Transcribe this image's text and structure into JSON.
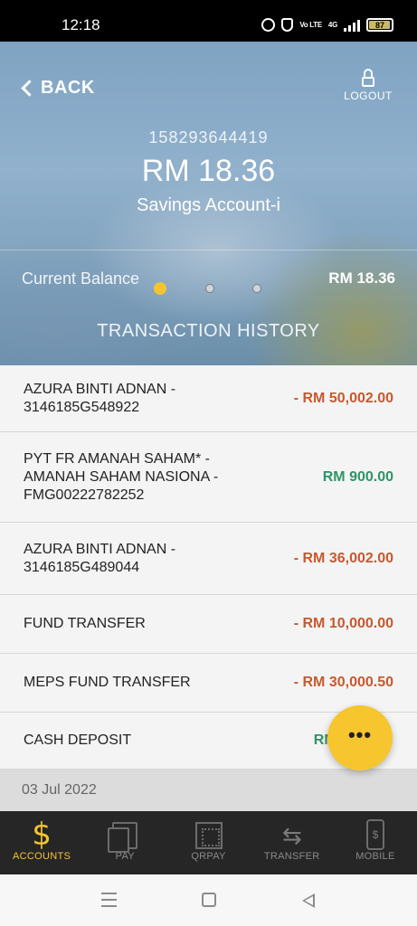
{
  "status_bar": {
    "time": "12:18",
    "network": "4G",
    "volte": "Vo LTE",
    "battery": "87"
  },
  "header": {
    "back_label": "BACK",
    "logout_label": "LOGOUT",
    "account_number": "158293644419",
    "balance": "RM 18.36",
    "account_type": "Savings Account-i",
    "current_balance_label": "Current Balance",
    "current_balance_value": "RM 18.36",
    "pager": {
      "count": 3,
      "active": 1
    },
    "section_title": "TRANSACTION HISTORY"
  },
  "transactions": [
    {
      "description": "AZURA BINTI ADNAN - 3146185G548922",
      "amount": "- RM 50,002.00",
      "type": "debit"
    },
    {
      "description": "PYT FR AMANAH SAHAM* - AMANAH SAHAM NASIONA - FMG00222782252",
      "amount": "RM 900.00",
      "type": "credit"
    },
    {
      "description": "AZURA BINTI ADNAN - 3146185G489044",
      "amount": "- RM 36,002.00",
      "type": "debit"
    },
    {
      "description": "FUND TRANSFER",
      "amount": "- RM 10,000.00",
      "type": "debit"
    },
    {
      "description": "MEPS FUND TRANSFER",
      "amount": "- RM 30,000.50",
      "type": "debit"
    },
    {
      "description": "CASH DEPOSIT",
      "amount": "RM 1",
      "type": "credit"
    }
  ],
  "date_header": "03 Jul 2022",
  "fab": {
    "label": "•••"
  },
  "bottom_nav": [
    {
      "label": "ACCOUNTS",
      "icon": "dollar-icon",
      "active": true
    },
    {
      "label": "PAY",
      "icon": "pay-icon",
      "active": false
    },
    {
      "label": "QRPAY",
      "icon": "qr-icon",
      "active": false
    },
    {
      "label": "TRANSFER",
      "icon": "transfer-icon",
      "active": false
    },
    {
      "label": "MOBILE",
      "icon": "mobile-icon",
      "active": false
    }
  ],
  "colors": {
    "accent": "#f4c430",
    "debit": "#c65a2e",
    "credit": "#2f9467",
    "nav_bg": "#262626"
  }
}
